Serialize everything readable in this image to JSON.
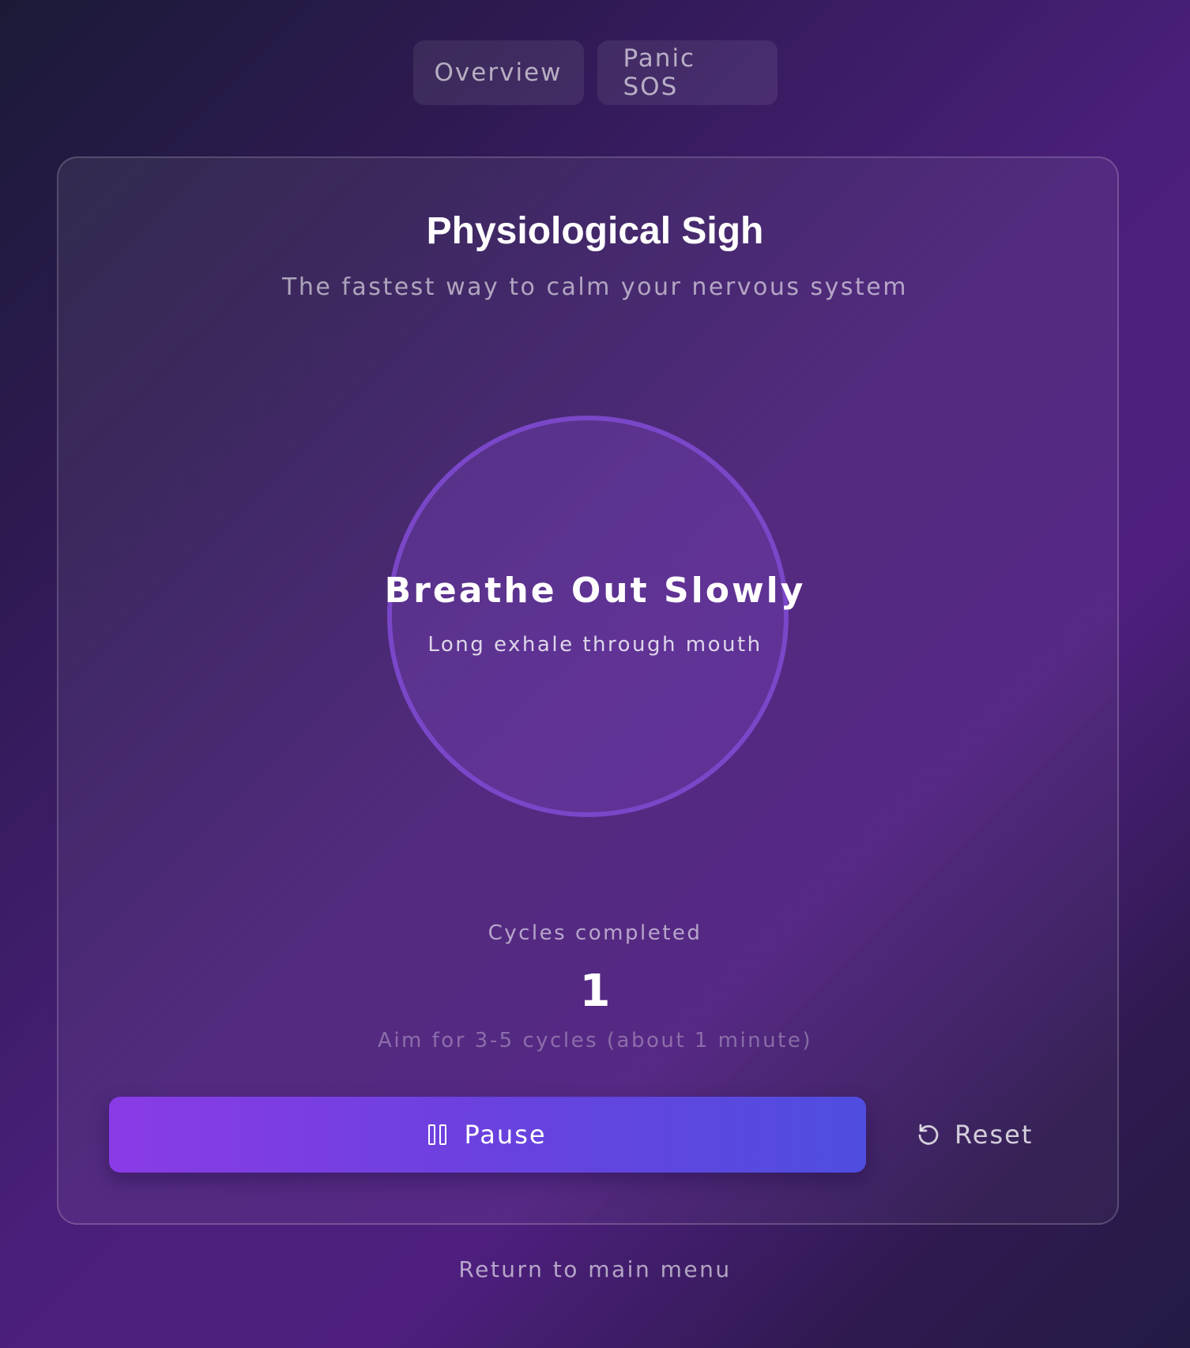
{
  "tabs": [
    {
      "label": "Overview"
    },
    {
      "label": "Panic SOS"
    }
  ],
  "exercise": {
    "title": "Physiological Sigh",
    "subtitle": "The fastest way to calm your nervous system"
  },
  "breath": {
    "phase": "Breathe Out Slowly",
    "instruction": "Long exhale through mouth"
  },
  "cycles": {
    "label": "Cycles completed",
    "value": "1",
    "goal": "Aim for 3-5 cycles (about 1 minute)"
  },
  "controls": {
    "pause_label": "Pause",
    "pause_icon": "pause-icon",
    "reset_label": "Reset",
    "reset_icon": "reset-icon"
  },
  "footer": {
    "return_label": "Return to main menu"
  },
  "colors": {
    "accent_start": "#8a3be6",
    "accent_end": "#4f4de0",
    "circle_border": "#7a47c9"
  }
}
